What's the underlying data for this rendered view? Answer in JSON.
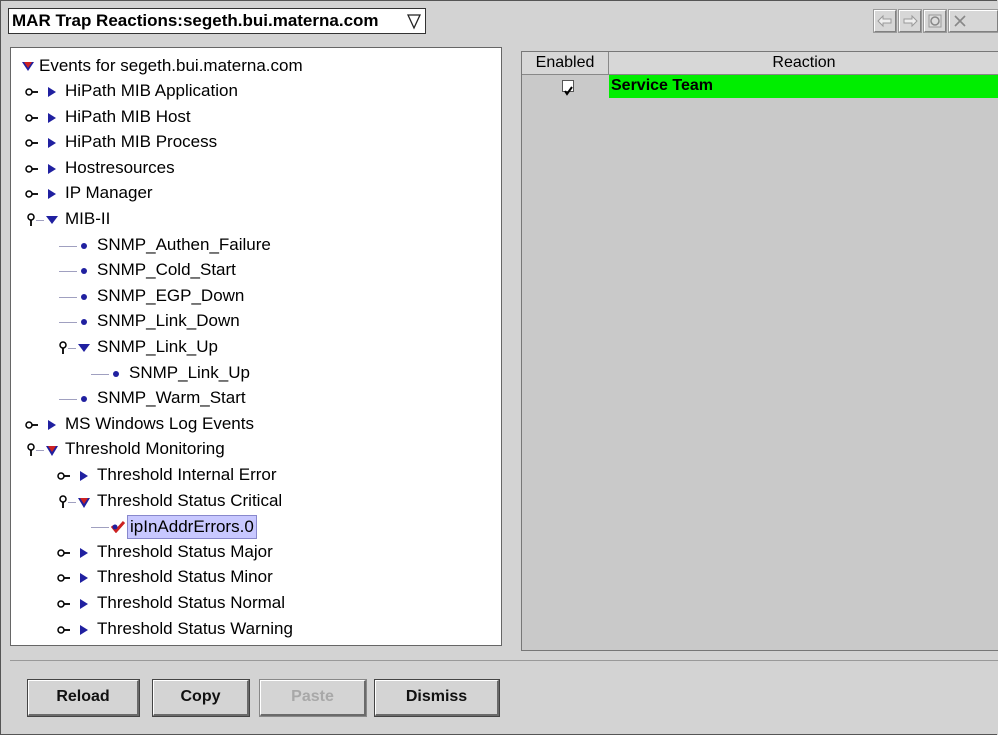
{
  "window": {
    "title": "MAR Trap Reactions:segeth.bui.materna.com"
  },
  "nav": {
    "icons": [
      "back-arrow-icon",
      "forward-arrow-icon",
      "refresh-icon",
      "close-icon"
    ]
  },
  "tree": {
    "root": "Events for segeth.bui.materna.com",
    "items": [
      {
        "label": "HiPath MIB Application"
      },
      {
        "label": "HiPath MIB Host"
      },
      {
        "label": "HiPath MIB Process"
      },
      {
        "label": "Hostresources"
      },
      {
        "label": "IP Manager"
      },
      {
        "label": "MIB-II"
      },
      {
        "label": "SNMP_Authen_Failure"
      },
      {
        "label": "SNMP_Cold_Start"
      },
      {
        "label": "SNMP_EGP_Down"
      },
      {
        "label": "SNMP_Link_Down"
      },
      {
        "label": "SNMP_Link_Up"
      },
      {
        "label": "SNMP_Link_Up"
      },
      {
        "label": "SNMP_Warm_Start"
      },
      {
        "label": "MS Windows Log Events"
      },
      {
        "label": "Threshold Monitoring"
      },
      {
        "label": "Threshold Internal Error"
      },
      {
        "label": "Threshold Status Critical"
      },
      {
        "label": "ipInAddrErrors.0"
      },
      {
        "label": "Threshold Status Major"
      },
      {
        "label": "Threshold Status Minor"
      },
      {
        "label": "Threshold Status Normal"
      },
      {
        "label": "Threshold Status Warning"
      }
    ]
  },
  "table": {
    "columns": [
      "Enabled",
      "Reaction"
    ],
    "rows": [
      {
        "enabled": true,
        "reaction": "Service Team",
        "color": "#00ee00"
      }
    ]
  },
  "buttons": {
    "reload": "Reload",
    "copy": "Copy",
    "paste": "Paste",
    "dismiss": "Dismiss"
  },
  "colors": {
    "selection": "#c8c8ff",
    "reaction_row": "#00ee00",
    "tree_arrow": "#2020a0",
    "error_marker": "#cc2222"
  }
}
